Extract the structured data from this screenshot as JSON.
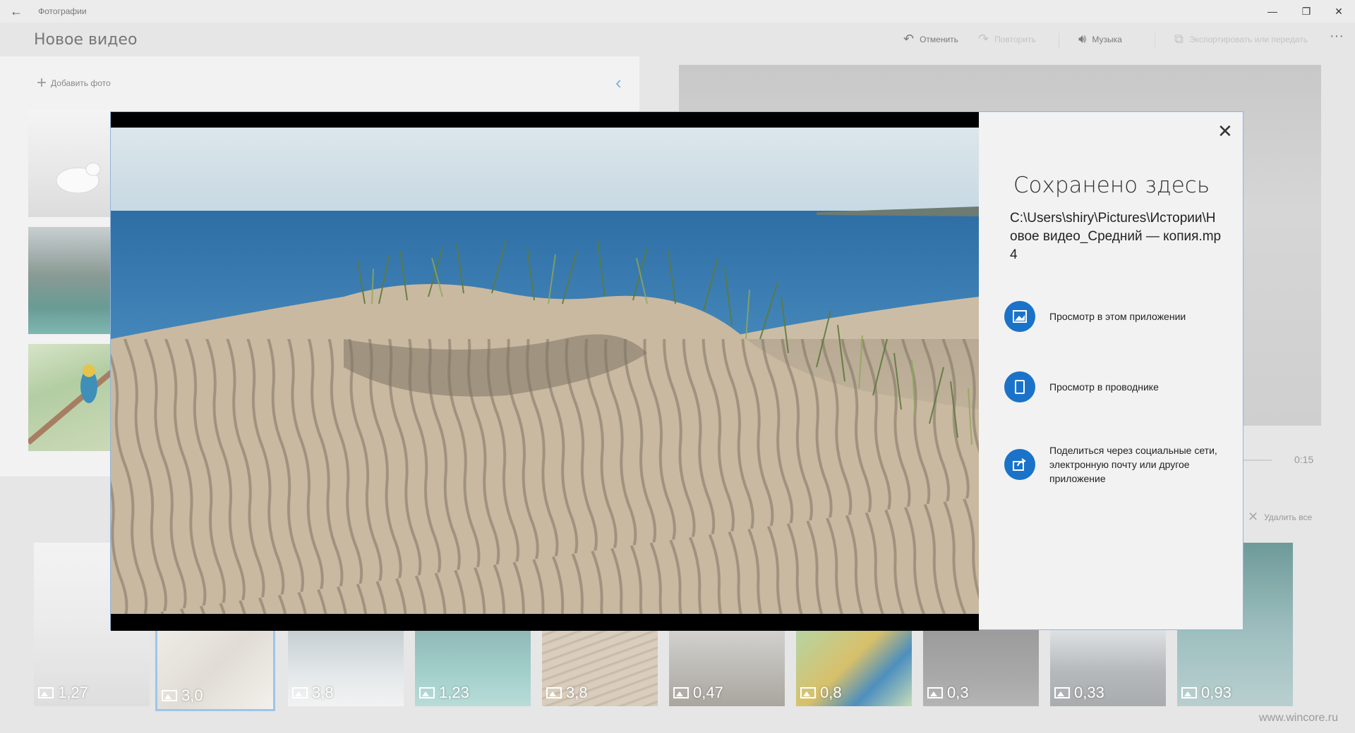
{
  "titlebar": {
    "app_name": "Фотографии",
    "back": "←",
    "minimize": "—",
    "restore": "❐",
    "close": "✕"
  },
  "header": {
    "project_title": "Новое видео",
    "undo": "Отменить",
    "redo": "Повторить",
    "music": "Музыка",
    "export": "Экспортировать или передать",
    "more": "···"
  },
  "library": {
    "add_photo": "Добавить фото",
    "add_icon": "+",
    "collapse_icon": "‹"
  },
  "preview": {
    "time_end": "0:15",
    "delete_all": "Удалить все"
  },
  "storyboard": {
    "cards": [
      {
        "duration": "1,27"
      },
      {
        "duration": "3,0"
      },
      {
        "duration": "3,8"
      },
      {
        "duration": "1,23"
      },
      {
        "duration": "3,8"
      },
      {
        "duration": "0,47"
      },
      {
        "duration": "0,8"
      },
      {
        "duration": "0,3"
      },
      {
        "duration": "0,33"
      },
      {
        "duration": "0,93"
      }
    ]
  },
  "dialog": {
    "title": "Сохранено здесь",
    "path": "C:\\Users\\shiry\\Pictures\\Истории\\Новое видео_Средний — копия.mp4",
    "close_icon": "✕",
    "options": [
      {
        "label": "Просмотр в этом приложении",
        "icon": "photo-app-icon"
      },
      {
        "label": "Просмотр в проводнике",
        "icon": "device-icon"
      },
      {
        "label": "Поделиться через социальные сети, электронную почту или другое приложение",
        "icon": "share-icon"
      }
    ]
  },
  "watermark": "www.wincore.ru",
  "colors": {
    "accent": "#1a73c9",
    "dialog_border": "#8fb4da",
    "selected_card": "#9cc6ea"
  }
}
